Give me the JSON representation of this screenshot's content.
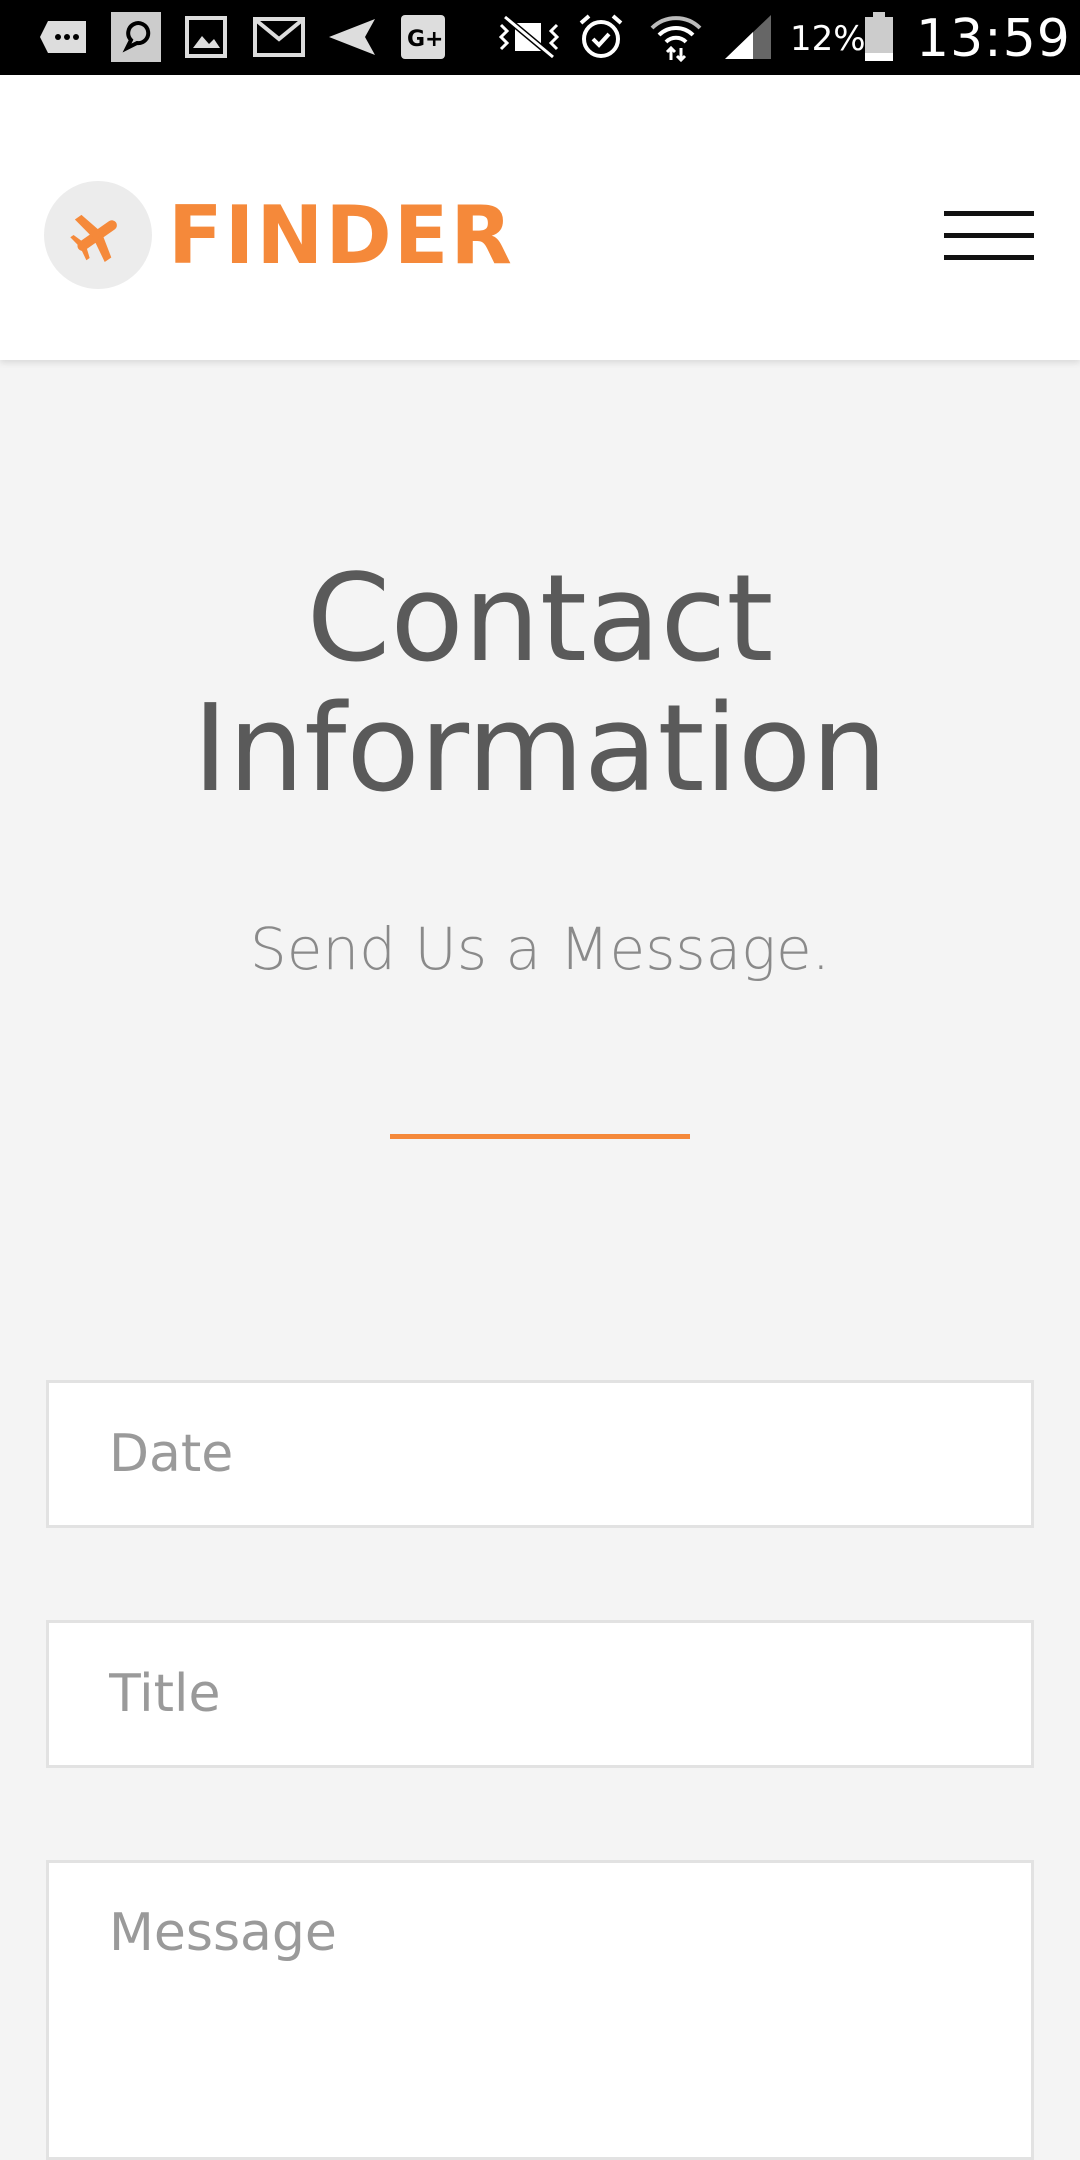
{
  "status_bar": {
    "battery_percent": "12%",
    "time": "13:59",
    "icons": [
      "messenger-icon",
      "tapatalk-icon",
      "gallery-icon",
      "gmail-icon",
      "send-icon",
      "google-plus-icon",
      "mute-vibrate-icon",
      "alarm-icon",
      "wifi-icon",
      "signal-icon",
      "battery-icon"
    ]
  },
  "header": {
    "brand": "FINDER",
    "logo_icon": "airplane-icon",
    "menu_icon": "hamburger-menu-icon"
  },
  "main": {
    "title": "Contact Information",
    "subtitle": "Send Us a Message."
  },
  "form": {
    "date_placeholder": "Date",
    "title_placeholder": "Title",
    "message_placeholder": "Message"
  },
  "colors": {
    "accent": "#f5893a",
    "background": "#f4f4f4",
    "heading": "#5a5a5a"
  }
}
